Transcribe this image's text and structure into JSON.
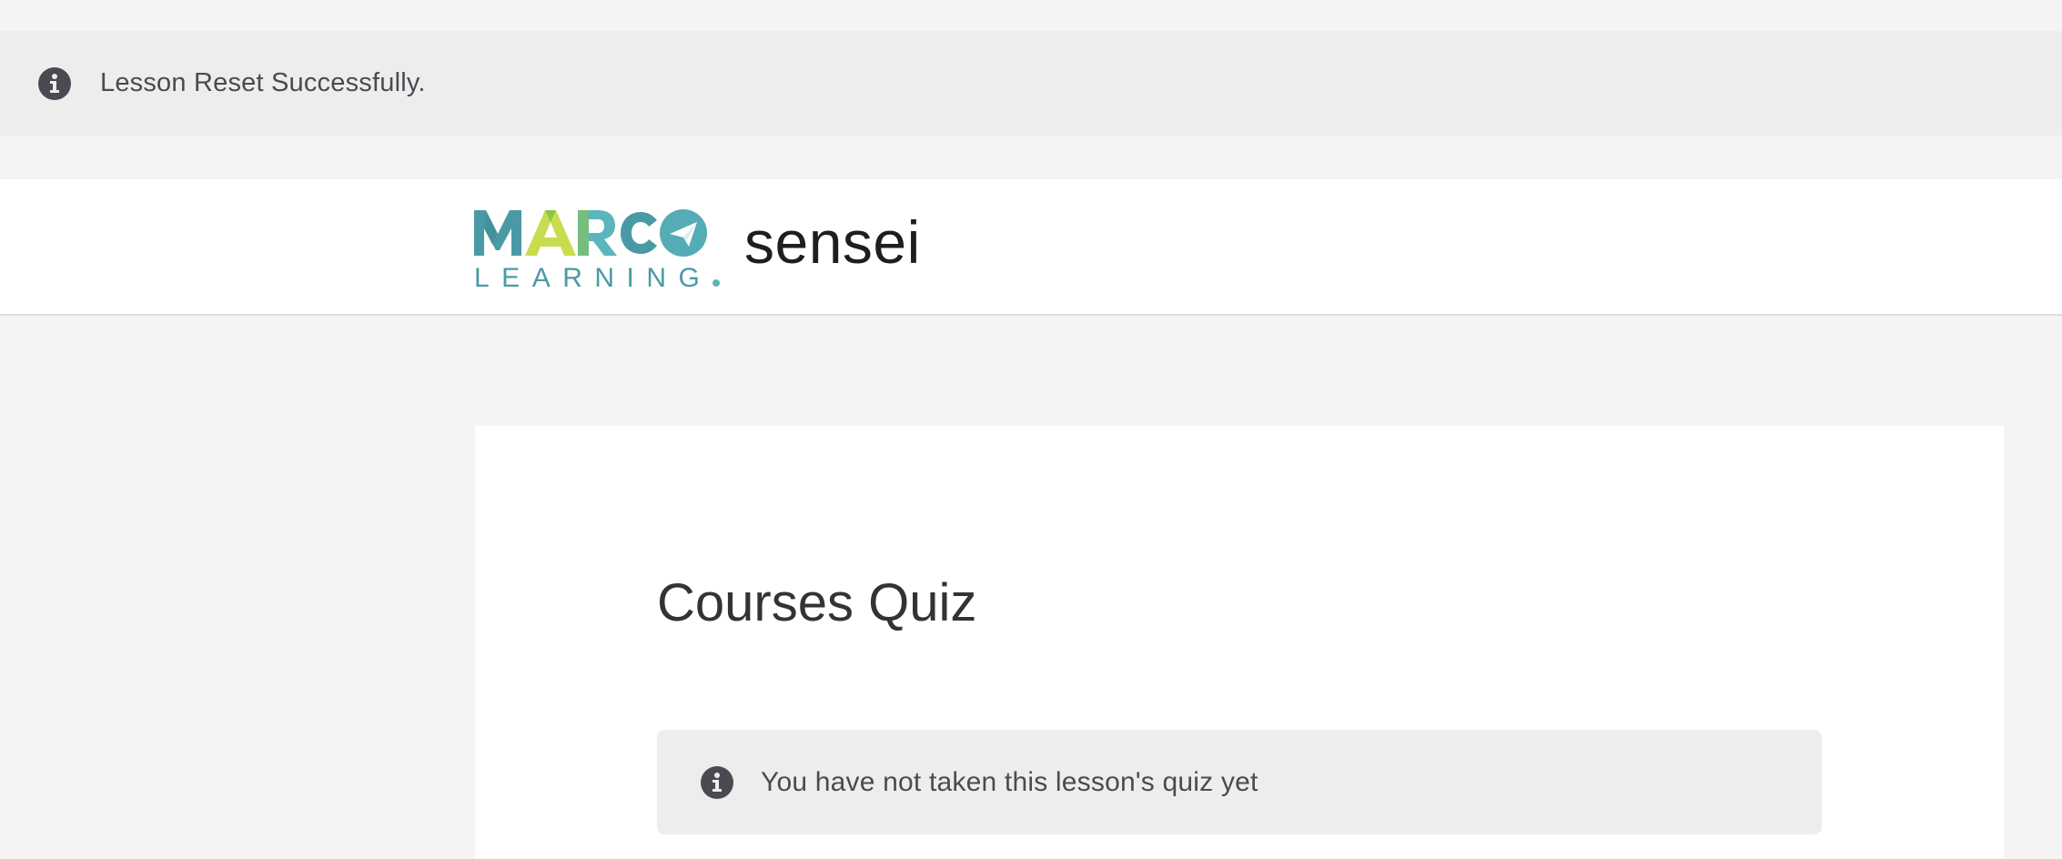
{
  "notice": {
    "icon": "info-icon",
    "message": "Lesson Reset Successfully."
  },
  "header": {
    "logo": {
      "line1": "MARCO",
      "line2": "LEARNING",
      "colors": {
        "teal": "#4a9aa6",
        "lime": "#c9dc4f",
        "green": "#8cc54a",
        "aqua": "#5bb5bd"
      }
    },
    "site_title": "sensei"
  },
  "main": {
    "lesson_title": "Courses Quiz",
    "quiz_notice": {
      "icon": "info-icon",
      "message": "You have not taken this lesson's quiz yet"
    }
  },
  "colors": {
    "page_background": "#f4f4f4",
    "notice_background": "#ededed",
    "icon": "#4a4a52",
    "card_background": "#ffffff"
  }
}
